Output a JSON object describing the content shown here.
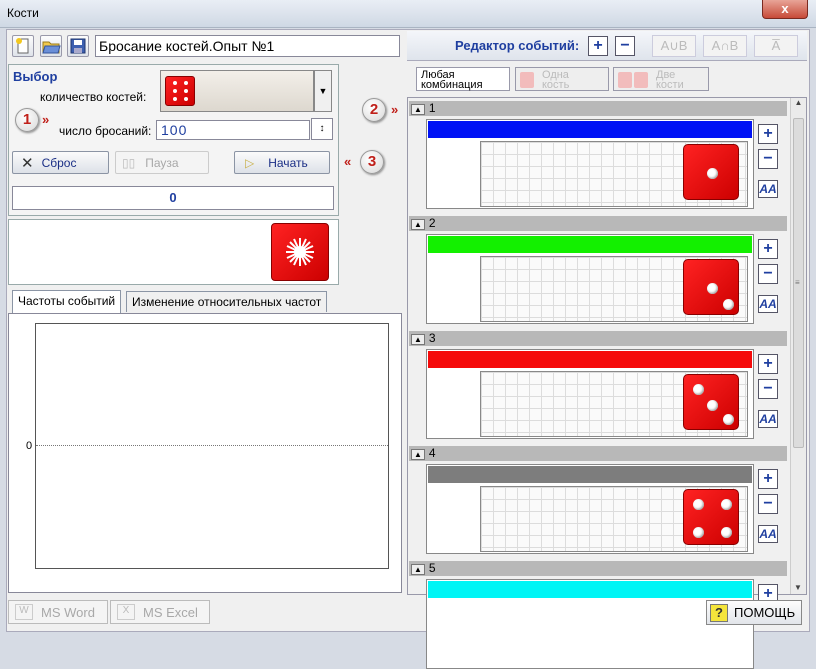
{
  "window": {
    "title": "Кости",
    "close_label": "x"
  },
  "toolbar": {
    "experiment_name": "Бросание костей.Опыт №1"
  },
  "choice": {
    "title": "Выбор",
    "dice_count_label": "количество костей:",
    "throws_label": "число бросаний:",
    "throws_value": "100"
  },
  "controls": {
    "reset": "Сброс",
    "pause": "Пауза",
    "start": "Начать",
    "counter": "0"
  },
  "callouts": {
    "c1": "1",
    "c2": "2",
    "c3": "3"
  },
  "tabs": {
    "freq": "Частоты событий",
    "rel": "Изменение относительных частот"
  },
  "chart_data": {
    "type": "bar",
    "categories": [],
    "values": [],
    "y_tick_labels": [
      "0"
    ]
  },
  "event_editor": {
    "title": "Редактор событий:",
    "add": "+",
    "remove": "−",
    "union": "A∪B",
    "intersection": "A∩B",
    "complement": "A̅"
  },
  "modes": {
    "any": {
      "line1": "Любая",
      "line2": "комбинация"
    },
    "one": {
      "line1": "Одна",
      "line2": "кость"
    },
    "two": {
      "line1": "Две",
      "line2": "кости"
    }
  },
  "events": [
    {
      "num": "1",
      "color": "#0012f5",
      "pips": 1
    },
    {
      "num": "2",
      "color": "#13f000",
      "pips": 2
    },
    {
      "num": "3",
      "color": "#f50a0a",
      "pips": 3
    },
    {
      "num": "4",
      "color": "#7d7d7d",
      "pips": 4
    },
    {
      "num": "5",
      "color": "#00f5f5",
      "pips": 0
    }
  ],
  "event_buttons": {
    "plus": "+",
    "minus": "−",
    "font": "AA"
  },
  "bottom": {
    "word": "MS Word",
    "excel": "MS Excel",
    "help": "ПОМОЩЬ",
    "help_icon": "?"
  }
}
